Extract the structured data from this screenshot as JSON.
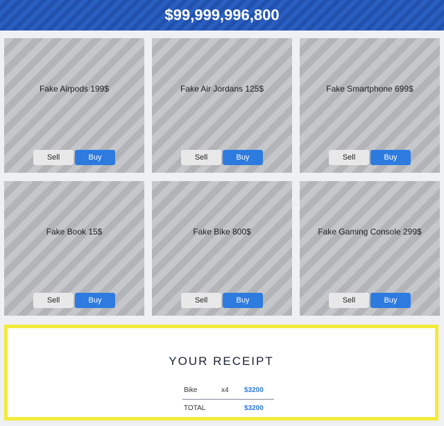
{
  "header": {
    "balance": "$99,999,996,800"
  },
  "products": [
    {
      "label": "Fake Airpods 199$",
      "sell": "Sell",
      "buy": "Buy"
    },
    {
      "label": "Fake Air Jordans 125$",
      "sell": "Sell",
      "buy": "Buy"
    },
    {
      "label": "Fake Smartphone 699$",
      "sell": "Sell",
      "buy": "Buy"
    },
    {
      "label": "Fake Book 15$",
      "sell": "Sell",
      "buy": "Buy"
    },
    {
      "label": "Fake Bike 800$",
      "sell": "Sell",
      "buy": "Buy"
    },
    {
      "label": "Fake Gaming Console 299$",
      "sell": "Sell",
      "buy": "Buy"
    }
  ],
  "receipt": {
    "title": "YOUR RECEIPT",
    "items": [
      {
        "name": "Bike",
        "qty": "x4",
        "amount": "$3200"
      }
    ],
    "total_label": "TOTAL",
    "total_amount": "$3200"
  },
  "colors": {
    "header_blue": "#2a5fc2",
    "buy_blue": "#2e7be0",
    "receipt_border": "#f3ea3a"
  }
}
